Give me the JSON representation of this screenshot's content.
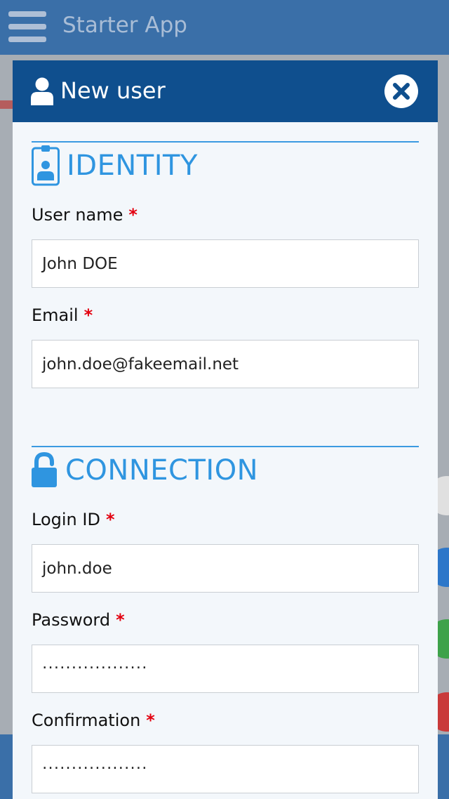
{
  "app": {
    "title": "Starter App"
  },
  "modal": {
    "title": "New user",
    "sections": {
      "identity": {
        "title": "IDENTITY",
        "fields": {
          "username": {
            "label": "User name",
            "required": "*",
            "value": "John DOE"
          },
          "email": {
            "label": "Email",
            "required": "*",
            "value": "john.doe@fakeemail.net"
          }
        }
      },
      "connection": {
        "title": "CONNECTION",
        "fields": {
          "login": {
            "label": "Login ID",
            "required": "*",
            "value": "john.doe"
          },
          "password": {
            "label": "Password",
            "required": "*",
            "value": "․․․․․․․․․․․․․․․․․․"
          },
          "confirmation": {
            "label": "Confirmation",
            "required": "*",
            "value": "․․․․․․․․․․․․․․․․․․"
          }
        }
      }
    }
  },
  "icons": {
    "menu": "hamburger-icon",
    "user": "user-icon",
    "close": "close-icon",
    "badge": "id-badge-icon",
    "unlock": "unlock-icon"
  },
  "colors": {
    "header": "#0f4f8e",
    "appbar": "#3a6fa8",
    "accent": "#2f95e0",
    "required": "#e3000f"
  }
}
